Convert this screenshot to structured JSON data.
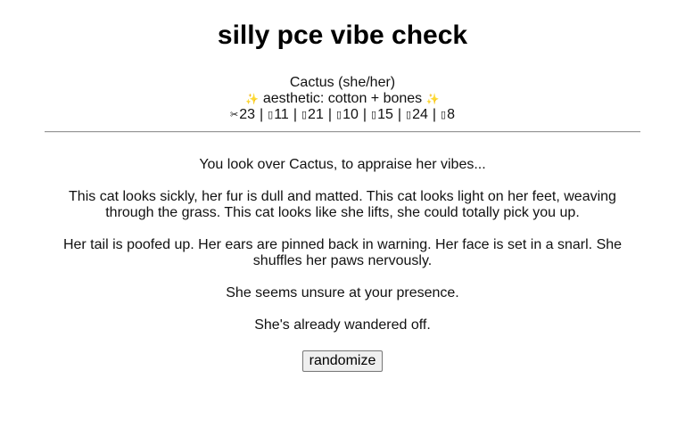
{
  "title": "silly pce vibe check",
  "cat": {
    "name_line": "Cactus (she/her)",
    "aesthetic_line": "aesthetic: cotton + bones",
    "sparkle_left": "✨",
    "sparkle_right": "✨",
    "stats": [
      {
        "icon": "scissors-icon",
        "glyph": "✂",
        "value": "23"
      },
      {
        "icon": "stat-icon-2",
        "glyph": "▯",
        "value": "11"
      },
      {
        "icon": "stat-icon-3",
        "glyph": "▯",
        "value": "21"
      },
      {
        "icon": "stat-icon-4",
        "glyph": "▯",
        "value": "10"
      },
      {
        "icon": "stat-icon-5",
        "glyph": "▯",
        "value": "15"
      },
      {
        "icon": "stat-icon-6",
        "glyph": "▯",
        "value": "24"
      },
      {
        "icon": "stat-icon-7",
        "glyph": "▯",
        "value": "8"
      }
    ]
  },
  "vibes": {
    "intro": "You look over Cactus, to appraise her vibes...",
    "appearance": "This cat looks sickly, her fur is dull and matted. This cat looks light on her feet, weaving through the grass. This cat looks like she lifts, she could totally pick you up.",
    "body_language": "Her tail is poofed up. Her ears are pinned back in warning. Her face is set in a snarl. She shuffles her paws nervously.",
    "presence": "She seems unsure at your presence.",
    "leaving": "She's already wandered off."
  },
  "randomize_label": "randomize"
}
